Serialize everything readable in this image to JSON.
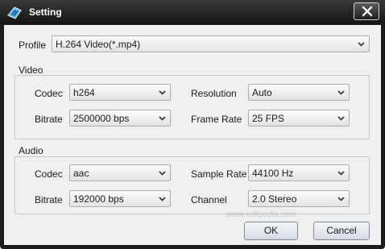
{
  "window": {
    "title": "Setting"
  },
  "profile": {
    "label": "Profile",
    "value": "H.264 Video(*.mp4)"
  },
  "video": {
    "group_label": "Video",
    "codec_label": "Codec",
    "codec_value": "h264",
    "bitrate_label": "Bitrate",
    "bitrate_value": "2500000 bps",
    "resolution_label": "Resolution",
    "resolution_value": "Auto",
    "framerate_label": "Frame Rate",
    "framerate_value": "25 FPS"
  },
  "audio": {
    "group_label": "Audio",
    "codec_label": "Codec",
    "codec_value": "aac",
    "bitrate_label": "Bitrate",
    "bitrate_value": "192000 bps",
    "samplerate_label": "Sample Rate",
    "samplerate_value": "44100 Hz",
    "channel_label": "Channel",
    "channel_value": "2.0 Stereo"
  },
  "buttons": {
    "ok": "OK",
    "cancel": "Cancel"
  },
  "watermark": "www.softpedia.com",
  "icons": {
    "app": "app-icon",
    "close": "close-icon",
    "dropdown": "chevron-down-icon"
  }
}
